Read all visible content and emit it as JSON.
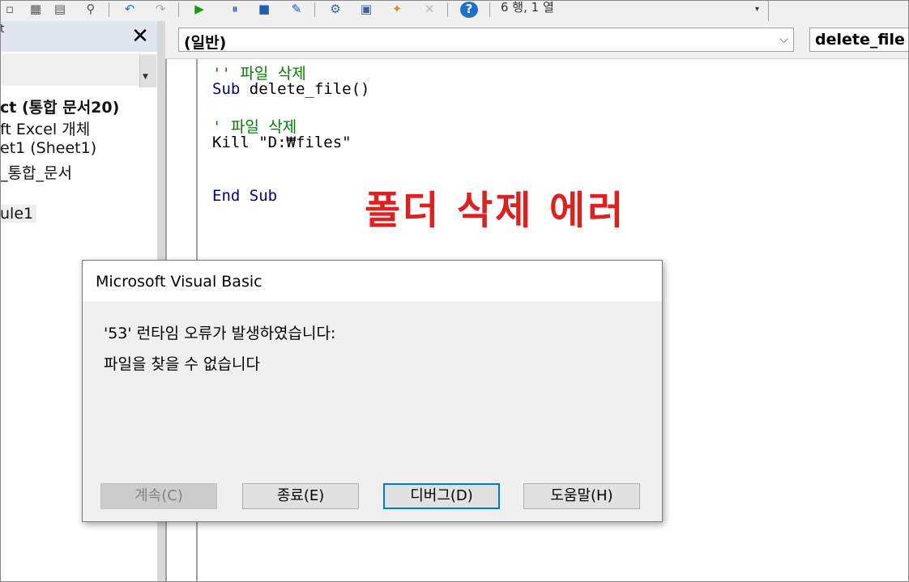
{
  "toolbar": {
    "cursor_position": "6 행, 1 열"
  },
  "project_panel": {
    "title": "t",
    "close_glyph": "✕",
    "tree": [
      {
        "label": "ct (통합 문서20)"
      },
      {
        "label": "ft Excel 개체"
      },
      {
        "label": "et1 (Sheet1)"
      },
      {
        "label": "_통합_문서"
      },
      {
        "label": "ule1"
      }
    ]
  },
  "code_window": {
    "object_combo": "(일반)",
    "procedure_combo": "delete_file",
    "lines": [
      {
        "text": "'' 파일 삭제"
      },
      {
        "text": "Sub delete_file()"
      },
      {
        "text": "' 파일 삭제"
      },
      {
        "text": "Kill \"D:₩files\""
      },
      {
        "text": "End Sub"
      }
    ]
  },
  "annotation": {
    "text": "폴더 삭제 에러",
    "color": "#e02020"
  },
  "dialog": {
    "title": "Microsoft Visual Basic",
    "message_line1": "'53' 런타임 오류가 발생하였습니다:",
    "message_line2": "파일을 찾을 수 없습니다",
    "buttons": [
      {
        "label": "계속(C)",
        "enabled": false
      },
      {
        "label": "종료(E)",
        "enabled": true
      },
      {
        "label": "디버그(D)",
        "enabled": true,
        "default": true
      },
      {
        "label": "도움말(H)",
        "enabled": true
      }
    ]
  }
}
